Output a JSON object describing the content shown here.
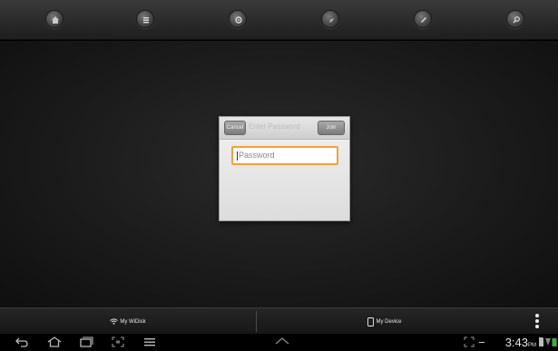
{
  "top_toolbar": {
    "icons": [
      "home-icon",
      "list-icon",
      "settings-icon",
      "compass-icon",
      "edit-icon",
      "search-icon"
    ]
  },
  "dialog": {
    "cancel_label": "Cancel",
    "title": "Enter Password",
    "join_label": "Join",
    "password_placeholder": "Password",
    "accent_color": "#f0a23c"
  },
  "bottom_tabs": {
    "wifi_label": "My WiDisk",
    "device_label": "My Device"
  },
  "system_bar": {
    "time": "3:43",
    "ampm": "PM"
  }
}
